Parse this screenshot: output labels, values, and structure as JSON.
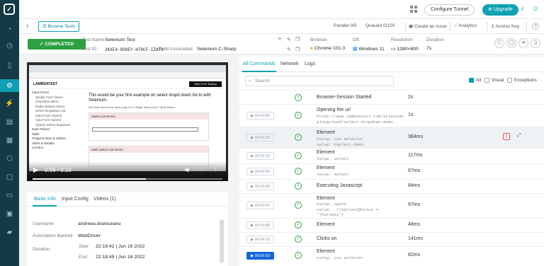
{
  "rail": {
    "items": [
      "home-icon",
      "dashboard-icon",
      "clock-icon",
      "mobile-icon",
      "automation-icon",
      "lightning-icon",
      "layers-icon",
      "document-icon",
      "cube-icon",
      "box-icon",
      "calendar-icon",
      "monitor-icon",
      "folder-icon"
    ]
  },
  "topbar": {
    "configure_tunnel": "Configure Tunnel",
    "upgrade": "Upgrade"
  },
  "subbar": {
    "browse_tests": "Browse Tests",
    "parallel_label": "Parallel",
    "parallel": "0/5",
    "queued_label": "Queued",
    "queued": "0/150",
    "create_issue": "Create an Issue",
    "analytics": "Analytics",
    "access_key": "Access Key",
    "help": "?"
  },
  "test": {
    "status": "COMPLETED",
    "name_label": "Test Name",
    "name": "Selenium Test",
    "id_label": "Test ID",
    "id": "3KXF4-8S0EY-H79CF-IZAT3",
    "build_label": "Build Associated",
    "build": "Selenium C-Sharp",
    "browser_label": "Browser",
    "browser": "Chrome 101.0",
    "os_label": "OS",
    "os": "Windows 11",
    "resolution_label": "Resolution",
    "resolution": "1280×800",
    "duration_label": "Duration",
    "duration": "7s"
  },
  "video": {
    "time": "0:06 / 0:10",
    "page_title": "This would be your first example on select dropd down list to with Selenium.",
    "sublist": "We have demo! test drive page for 1 Single Select and 1 Multi Select",
    "select_demo": "Select List Demo",
    "multi_demo": "Multi Select List Demo",
    "logo": "LAMBDATEST",
    "nav": [
      "Input Forms",
      "Simple Form Demo",
      "Checkbox demo",
      "Radio Buttons Demo",
      "Select Dropdown List",
      "Input Form Submit",
      "Ajax Form Submit",
      "JQuery Select dropdown",
      "Date Pickers",
      "Table",
      "Progress Bars & Sliders",
      "Alerts & Modals",
      "List Box"
    ]
  },
  "left_tabs": {
    "basic": "Basic Info",
    "input": "Input Config",
    "videos": "Videos (1)"
  },
  "basic": {
    "username_label": "Username",
    "username": "andreea.draniceanu",
    "backend_label": "Automation Backed",
    "backend": "WebDriver",
    "duration_label": "Duration",
    "start_label": "Start",
    "start": "22:18:42 | Jun 16 2022",
    "end_label": "End",
    "end": "22:18:49 | Jun 16 2022"
  },
  "right_tabs": {
    "all": "All Commands",
    "network": "Network",
    "logs": "Logs"
  },
  "filters": {
    "search_placeholder": "Search",
    "all": "All",
    "visual": "Visual",
    "exceptions": "Exceptions"
  },
  "commands": [
    {
      "time": "",
      "name": "Browser-Session Started",
      "sub": "",
      "dur": "2s"
    },
    {
      "time": "00:00:00",
      "name": "Opening the url",
      "sub": "https://www.lambdatest.com/selenium-\nplayground/select-dropdown-demo",
      "dur": "1s"
    },
    {
      "time": "00:01:32",
      "name": "Element",
      "sub": "using: css selector\nvalue: #select-demo",
      "dur": "384ms"
    },
    {
      "time": "00:02:15",
      "name": "Element",
      "sub": "Value: select",
      "dur": "117ms"
    },
    {
      "time": "00:02:65",
      "name": "Element",
      "sub": "Value: select",
      "dur": "67ms"
    },
    {
      "time": "00:03:06",
      "name": "Executing Javascript",
      "sub": "",
      "dur": "84ms"
    },
    {
      "time": "00:03:47",
      "name": "Element",
      "sub": "using: xpath\nvalue: .//option[@value =\n'Thursday']",
      "dur": "67ms"
    },
    {
      "time": "00:03:88",
      "name": "Element",
      "sub": "",
      "dur": "48ms"
    },
    {
      "time": "00:04:29",
      "name": "Clicks on",
      "sub": "",
      "dur": "141ms"
    },
    {
      "time": "00:05:53",
      "name": "Element",
      "sub": "using: css selector",
      "dur": "82ms"
    }
  ]
}
